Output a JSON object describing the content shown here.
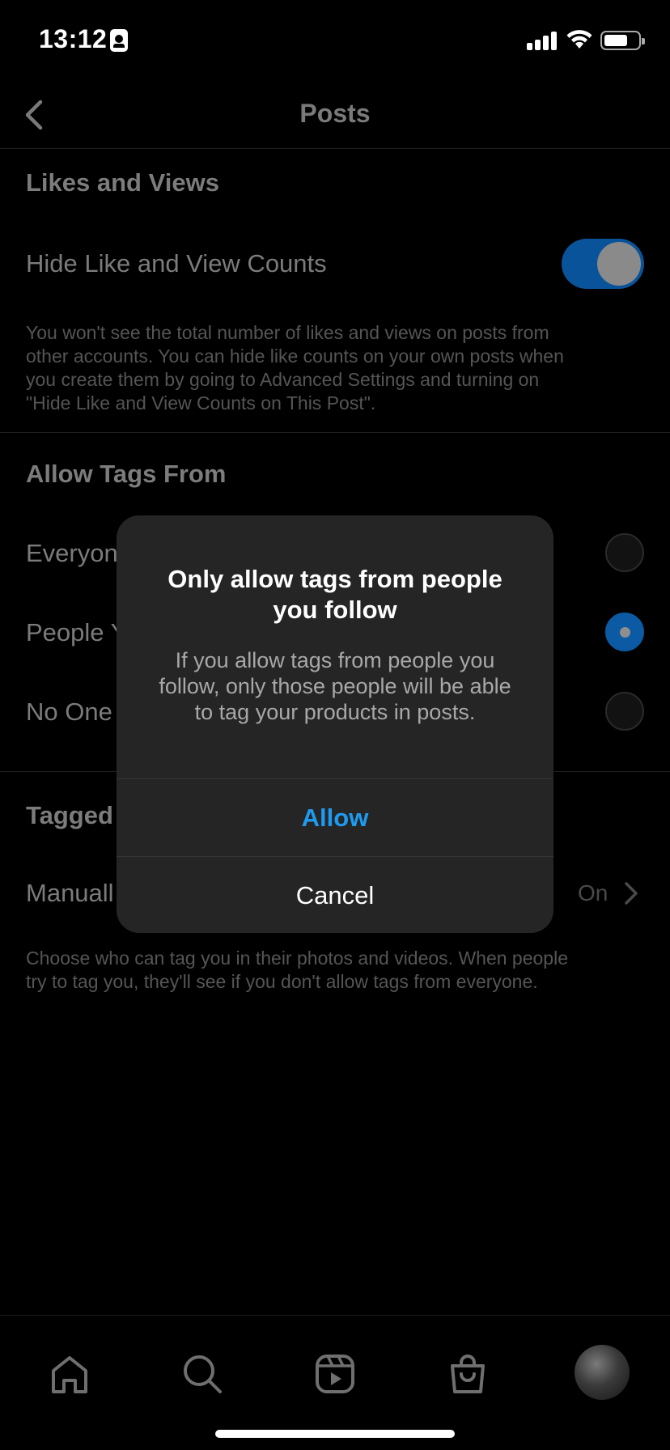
{
  "status_bar": {
    "time": "13:12"
  },
  "header": {
    "title": "Posts"
  },
  "likes_section": {
    "title": "Likes and Views",
    "toggle_label": "Hide Like and View Counts",
    "toggle_on": true,
    "description_lines": [
      "You won't see the total number of likes and views on posts from",
      "other accounts. You can hide like counts on your own posts when",
      "you create them by going to Advanced Settings and turning on",
      "\"Hide Like and View Counts on This Post\"."
    ]
  },
  "tags_section": {
    "title": "Allow Tags From",
    "options": [
      {
        "label": "Everyon",
        "selected": false
      },
      {
        "label": "People Y",
        "selected": true
      },
      {
        "label": "No One",
        "selected": false
      }
    ]
  },
  "tagged_section": {
    "title": "Tagged",
    "row_label": "Manuall",
    "row_value": "On",
    "description_lines": [
      "Choose who can tag you in their photos and videos. When people",
      "try to tag you, they'll see if you don't allow tags from everyone."
    ]
  },
  "dialog": {
    "title_lines": [
      "Only allow tags from people",
      "you follow"
    ],
    "body_lines": [
      "If you allow tags from people you",
      "follow, only those people will be able",
      "to tag your products in posts."
    ],
    "allow_label": "Allow",
    "cancel_label": "Cancel"
  },
  "tab_bar": {
    "icons": [
      "home-icon",
      "search-icon",
      "reels-icon",
      "shop-icon",
      "profile-avatar"
    ]
  },
  "colors": {
    "accent_blue": "#1e9bf0",
    "toggle_on": "#08539a",
    "dialog_bg": "#252525"
  }
}
